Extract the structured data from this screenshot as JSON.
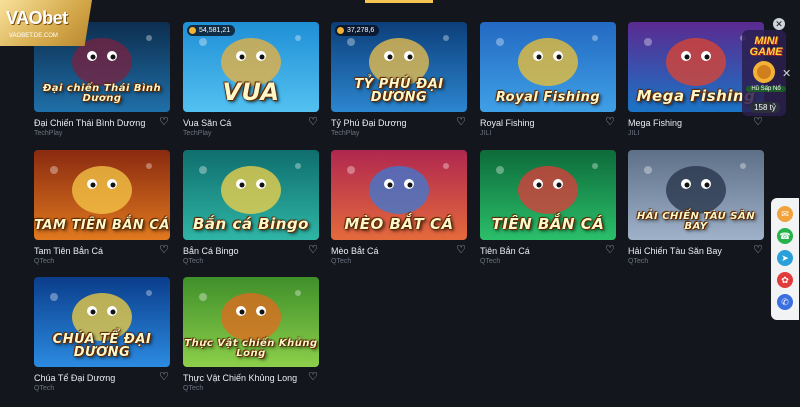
{
  "brand": {
    "logo_text": "VAObet",
    "logo_url": "VAOBET.DE.COM"
  },
  "mini_game": {
    "title": "MINI GAME",
    "sub": "Hũ Sấp Nổ",
    "badge": "158 tỷ"
  },
  "games": [
    {
      "name": "Đại Chiến Thái Bình Dương",
      "provider": "TechPlay",
      "art": "Đại chiến Thái Bình Dương",
      "jackpot": "",
      "colors": [
        "#0d2e4f",
        "#1f6fa8",
        "#7a2140"
      ]
    },
    {
      "name": "Vua Săn Cá",
      "provider": "TechPlay",
      "art": "VUA",
      "jackpot": "54,581,21",
      "colors": [
        "#1f8fd6",
        "#53c1f0",
        "#f0b23a"
      ]
    },
    {
      "name": "Tỷ Phú Đại Dương",
      "provider": "TechPlay",
      "art": "TỶ PHÚ ĐẠI DƯƠNG",
      "jackpot": "37,278,6",
      "colors": [
        "#0c3f7a",
        "#2c86d0",
        "#f2c14a"
      ]
    },
    {
      "name": "Royal Fishing",
      "provider": "JILI",
      "art": "Royal Fishing",
      "jackpot": "",
      "colors": [
        "#2369c2",
        "#3fa0e6",
        "#f1c232"
      ]
    },
    {
      "name": "Mega Fishing",
      "provider": "JILI",
      "art": "Mega Fishing",
      "jackpot": "",
      "colors": [
        "#5b2a90",
        "#1b74c6",
        "#e0442e"
      ]
    },
    {
      "name": "Tam Tiên Bắn Cá",
      "provider": "QTech",
      "art": "TAM TIÊN BẮN CÁ",
      "jackpot": "",
      "colors": [
        "#8a2a10",
        "#e0791f",
        "#f7c948"
      ]
    },
    {
      "name": "Bắn Cá Bingo",
      "provider": "QTech",
      "art": "Bắn cá Bingo",
      "jackpot": "",
      "colors": [
        "#0f6e6e",
        "#2fb5a5",
        "#f6d14a"
      ]
    },
    {
      "name": "Mèo Bắt Cá",
      "provider": "QTech",
      "art": "MÈO BẮT CÁ",
      "jackpot": "",
      "colors": [
        "#b0274f",
        "#e46a3c",
        "#3a7bd5"
      ]
    },
    {
      "name": "Tiên Bắn Cá",
      "provider": "QTech",
      "art": "TIÊN BẮN CÁ",
      "jackpot": "",
      "colors": [
        "#0d6b3a",
        "#2bbf6a",
        "#e23b3b"
      ]
    },
    {
      "name": "Hải Chiến Tàu Săn Bay",
      "provider": "QTech",
      "art": "HẢI CHIẾN TÀU SÂN BAY",
      "jackpot": "",
      "colors": [
        "#5e6f88",
        "#9fb2c9",
        "#243247"
      ]
    },
    {
      "name": "Chúa Tể Đại Dương",
      "provider": "QTech",
      "art": "CHÚA TỂ ĐẠI DƯƠNG",
      "jackpot": "",
      "colors": [
        "#0b3d8c",
        "#2b8be0",
        "#f4d03f"
      ]
    },
    {
      "name": "Thực Vật Chiến Khủng Long",
      "provider": "QTech",
      "art": "Thực Vật chiến Khủng Long",
      "jackpot": "",
      "colors": [
        "#3f8f2a",
        "#8ccf4a",
        "#e36a1f"
      ]
    }
  ],
  "social": [
    {
      "icon": "chat-icon",
      "color": "#f0a23c",
      "glyph": "✉"
    },
    {
      "icon": "support-icon",
      "color": "#27b34b",
      "glyph": "☎"
    },
    {
      "icon": "telegram-icon",
      "color": "#2a9fd8",
      "glyph": "➤"
    },
    {
      "icon": "gift-icon",
      "color": "#e23b3b",
      "glyph": "✿"
    },
    {
      "icon": "messenger-icon",
      "color": "#3b6fe0",
      "glyph": "✆"
    }
  ]
}
